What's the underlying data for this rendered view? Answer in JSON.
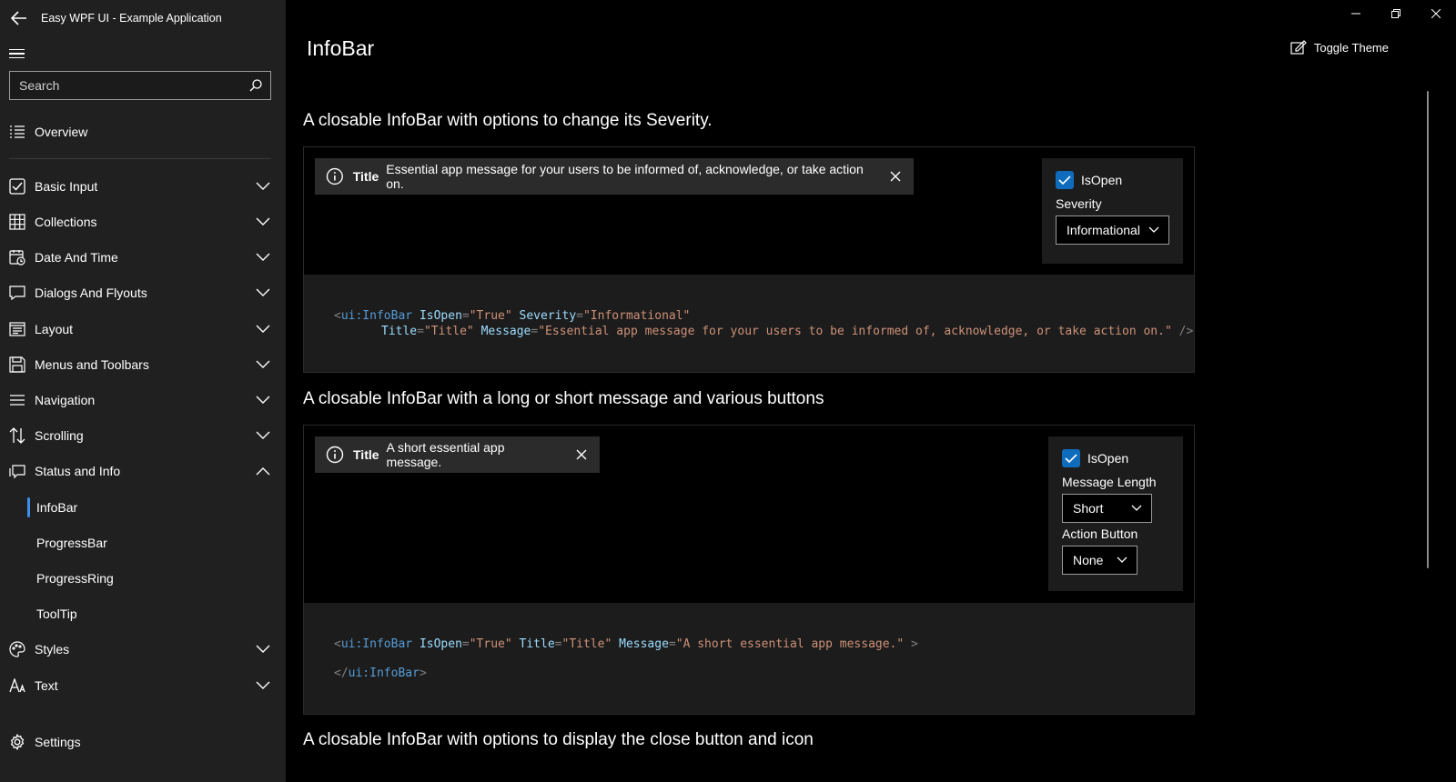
{
  "app": {
    "title": "Easy WPF UI - Example Application"
  },
  "search": {
    "placeholder": "Search"
  },
  "nav": {
    "overview": "Overview",
    "items": [
      {
        "label": "Basic Input"
      },
      {
        "label": "Collections"
      },
      {
        "label": "Date And Time"
      },
      {
        "label": "Dialogs And Flyouts"
      },
      {
        "label": "Layout"
      },
      {
        "label": "Menus and Toolbars"
      },
      {
        "label": "Navigation"
      },
      {
        "label": "Scrolling"
      },
      {
        "label": "Status and Info"
      }
    ],
    "sub_items": [
      {
        "label": "InfoBar",
        "selected": true
      },
      {
        "label": "ProgressBar"
      },
      {
        "label": "ProgressRing"
      },
      {
        "label": "ToolTip"
      }
    ],
    "after_items": [
      {
        "label": "Styles"
      },
      {
        "label": "Text"
      }
    ],
    "settings": "Settings"
  },
  "header": {
    "title": "InfoBar",
    "toggle_theme": "Toggle Theme"
  },
  "sections": [
    {
      "title": "A closable InfoBar with options to change its Severity.",
      "infobar": {
        "title": "Title",
        "message": "Essential app message for your users to be informed of, acknowledge, or take action on."
      },
      "options": {
        "isopen_label": "IsOpen",
        "isopen_checked": true,
        "severity_label": "Severity",
        "severity_value": "Informational"
      },
      "code": {
        "line1": {
          "open": "<",
          "tag": "ui:InfoBar",
          "attr1": "IsOpen",
          "eq1": "=",
          "val1": "\"True\"",
          "attr2": "Severity",
          "eq2": "=",
          "val2": "\"Informational\""
        },
        "line2": {
          "attr3": "Title",
          "eq3": "=",
          "val3": "\"Title\"",
          "attr4": "Message",
          "eq4": "=",
          "val4": "\"Essential app message for your users to be informed of, acknowledge, or take action on.\"",
          "close": "/>"
        }
      }
    },
    {
      "title": "A closable InfoBar with a long or short message and various buttons",
      "infobar": {
        "title": "Title",
        "message": "A short essential app message."
      },
      "options": {
        "isopen_label": "IsOpen",
        "isopen_checked": true,
        "length_label": "Message Length",
        "length_value": "Short",
        "action_label": "Action Button",
        "action_value": "None"
      },
      "code": {
        "line1": {
          "open": "<",
          "tag": "ui:InfoBar",
          "attr1": "IsOpen",
          "eq1": "=",
          "val1": "\"True\"",
          "attr2": "Title",
          "eq2": "=",
          "val2": "\"Title\"",
          "attr3": "Message",
          "eq3": "=",
          "val3": "\"A short essential app message.\"",
          "close": ">"
        },
        "line2": {
          "open": "</",
          "tag": "ui:InfoBar",
          "close": ">"
        }
      }
    },
    {
      "title": "A closable InfoBar with options to display the close button and icon"
    }
  ],
  "colors": {
    "accent": "#0f6cbd",
    "selection_bar": "#3b8eea",
    "sidebar_bg": "#202020",
    "code_bg": "#1c1c1c",
    "infobar_bg": "#2b2b2b"
  },
  "icons": [
    "back-arrow-icon",
    "hamburger-icon",
    "search-icon",
    "overview-icon",
    "checkbox-icon",
    "grid-icon",
    "calendar-icon",
    "chat-icon",
    "layout-icon",
    "save-icon",
    "menu-icon",
    "sort-icon",
    "info-icon",
    "palette-icon",
    "font-icon",
    "gear-icon",
    "close-icon",
    "chevron-down-icon",
    "chevron-up-icon",
    "pen-icon",
    "minimize-icon",
    "restore-icon"
  ]
}
